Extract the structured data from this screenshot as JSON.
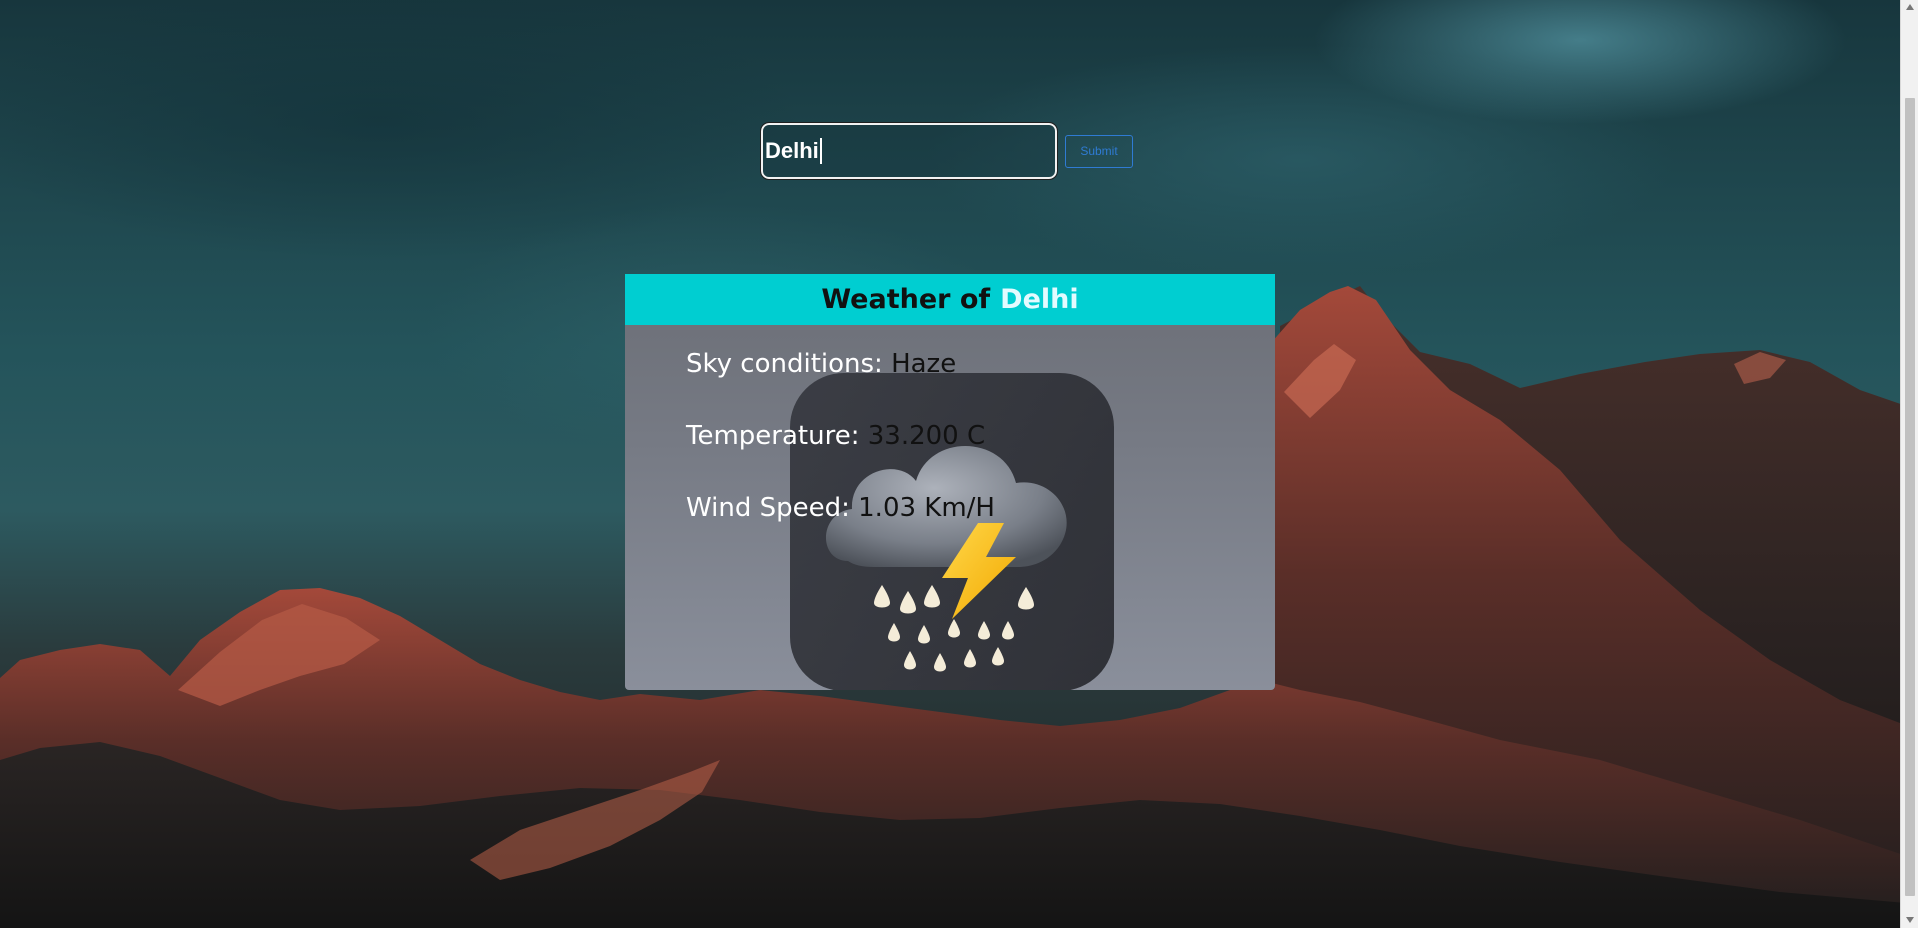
{
  "search": {
    "value": "Delhi",
    "submit_label": "Submit"
  },
  "weather": {
    "header_prefix": "Weather of",
    "header_city": "Delhi",
    "sky_label": "Sky conditions:",
    "sky_value": "Haze",
    "temp_label": "Temperature:",
    "temp_value": "33.200 C",
    "wind_label": "Wind Speed:",
    "wind_value": "1.03 Km/H"
  },
  "icons": {
    "weather_icon": "thunderstorm-rain-icon"
  },
  "colors": {
    "header_background": "#00ced1",
    "header_city_text": "#e3fbff",
    "submit_border": "#2f7bd3",
    "label_text": "#ffffff",
    "value_text": "#111111"
  }
}
